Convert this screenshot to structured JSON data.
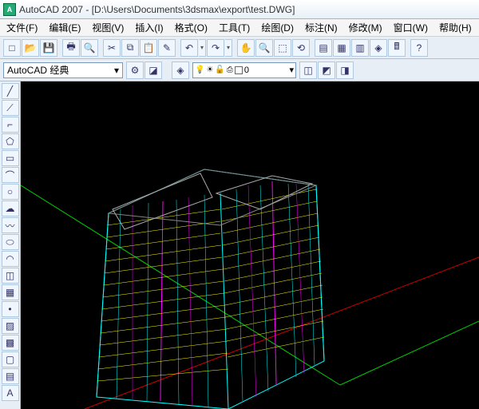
{
  "title": "AutoCAD 2007 - [D:\\Users\\Documents\\3dsmax\\export\\test.DWG]",
  "app_icon_text": "A",
  "menus": [
    {
      "label": "文件(F)"
    },
    {
      "label": "编辑(E)"
    },
    {
      "label": "视图(V)"
    },
    {
      "label": "插入(I)"
    },
    {
      "label": "格式(O)"
    },
    {
      "label": "工具(T)"
    },
    {
      "label": "绘图(D)"
    },
    {
      "label": "标注(N)"
    },
    {
      "label": "修改(M)"
    },
    {
      "label": "窗口(W)"
    },
    {
      "label": "帮助(H)"
    }
  ],
  "toolbar1_icons": [
    {
      "name": "new-icon",
      "glyph": "□"
    },
    {
      "name": "open-icon",
      "glyph": "📂"
    },
    {
      "name": "save-icon",
      "glyph": "💾"
    },
    {
      "name": "sep"
    },
    {
      "name": "plot-icon",
      "glyph": "🖶"
    },
    {
      "name": "preview-icon",
      "glyph": "🔍"
    },
    {
      "name": "sep"
    },
    {
      "name": "cut-icon",
      "glyph": "✂"
    },
    {
      "name": "copy-icon",
      "glyph": "⧉"
    },
    {
      "name": "paste-icon",
      "glyph": "📋"
    },
    {
      "name": "match-icon",
      "glyph": "✎"
    },
    {
      "name": "sep"
    },
    {
      "name": "undo-icon",
      "glyph": "↶",
      "dd": true
    },
    {
      "name": "redo-icon",
      "glyph": "↷",
      "dd": true
    },
    {
      "name": "sep"
    },
    {
      "name": "pan-icon",
      "glyph": "✋"
    },
    {
      "name": "zoom-rt-icon",
      "glyph": "🔍"
    },
    {
      "name": "zoom-win-icon",
      "glyph": "⬚"
    },
    {
      "name": "zoom-prev-icon",
      "glyph": "⟲"
    },
    {
      "name": "sep"
    },
    {
      "name": "props-icon",
      "glyph": "▤"
    },
    {
      "name": "dc-icon",
      "glyph": "▦"
    },
    {
      "name": "tp-icon",
      "glyph": "▥"
    },
    {
      "name": "layers-icon",
      "glyph": "◈"
    },
    {
      "name": "calc-icon",
      "glyph": "🖩"
    },
    {
      "name": "sep"
    },
    {
      "name": "help-icon",
      "glyph": "?"
    }
  ],
  "workspace": {
    "selected": "AutoCAD 经典",
    "chevron": "▾"
  },
  "ws_icons": [
    {
      "name": "ws-settings-icon",
      "glyph": "⚙"
    },
    {
      "name": "ws-lock-icon",
      "glyph": "◪"
    }
  ],
  "layer_panel": {
    "lp_icon": "◈",
    "bulb": "💡",
    "sun": "☀",
    "lock": "🔓",
    "plot": "⎙",
    "color_swatch": "#ffffff",
    "name": "0",
    "chevron": "▾"
  },
  "layer_icons_right": [
    {
      "name": "layer-states-icon",
      "glyph": "◫"
    },
    {
      "name": "layer-prev-icon",
      "glyph": "◩"
    },
    {
      "name": "layer-tools-icon",
      "glyph": "◨"
    }
  ],
  "vtools": [
    {
      "name": "line-tool",
      "glyph": "╱"
    },
    {
      "name": "xline-tool",
      "glyph": "⟋"
    },
    {
      "name": "pline-tool",
      "glyph": "⌐"
    },
    {
      "name": "polygon-tool",
      "glyph": "⬠"
    },
    {
      "name": "rect-tool",
      "glyph": "▭"
    },
    {
      "name": "arc-tool",
      "glyph": "⌒"
    },
    {
      "name": "circle-tool",
      "glyph": "○"
    },
    {
      "name": "revcloud-tool",
      "glyph": "☁"
    },
    {
      "name": "spline-tool",
      "glyph": "〰"
    },
    {
      "name": "ellipse-tool",
      "glyph": "⬭"
    },
    {
      "name": "ellipsearc-tool",
      "glyph": "◠"
    },
    {
      "name": "insert-tool",
      "glyph": "◫"
    },
    {
      "name": "block-tool",
      "glyph": "▦"
    },
    {
      "name": "point-tool",
      "glyph": "•"
    },
    {
      "name": "hatch-tool",
      "glyph": "▨"
    },
    {
      "name": "gradient-tool",
      "glyph": "▩"
    },
    {
      "name": "region-tool",
      "glyph": "▢"
    },
    {
      "name": "table-tool",
      "glyph": "▤"
    },
    {
      "name": "mtext-tool",
      "glyph": "A"
    }
  ]
}
